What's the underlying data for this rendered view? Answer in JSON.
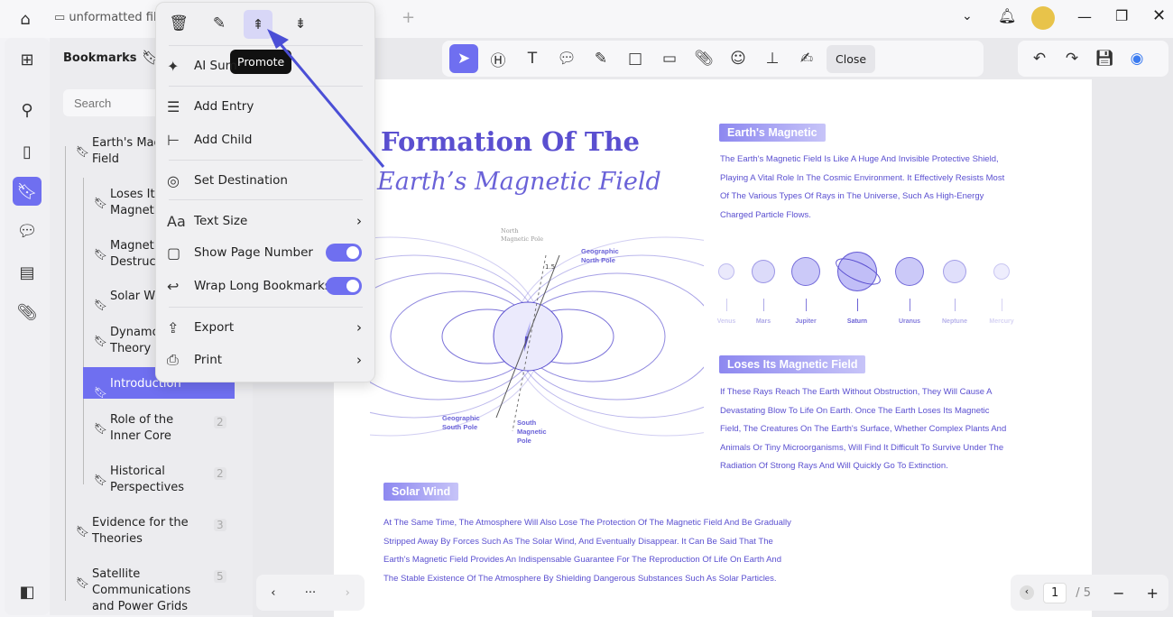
{
  "tab": {
    "title": "unformatted file"
  },
  "panel": {
    "title": "Bookmarks",
    "search_placeholder": "Search"
  },
  "bookmarks": [
    {
      "label": "Earth's Magnetic Field",
      "shown": "Earth's Mag\nField"
    },
    {
      "label": "Loses Its Magnetic",
      "shown": "Loses Its\nMagneti"
    },
    {
      "label": "Magnetic Destruct",
      "shown": "Magneti\nDestruct"
    },
    {
      "label": "Solar Wind",
      "shown": "Solar W"
    },
    {
      "label": "Dynamo Theory",
      "shown": "Dynamo\nTheory"
    },
    {
      "label": "Introduction",
      "shown": "Introduction"
    },
    {
      "label": "Role of the Inner Core",
      "shown": "Role of the\nInner Core",
      "page": "2"
    },
    {
      "label": "Historical Perspectives",
      "shown": "Historical\nPerspectives",
      "page": "2"
    },
    {
      "label": "Evidence for the Theories",
      "shown": "Evidence for the\nTheories",
      "page": "3"
    },
    {
      "label": "Satellite Communications and Power Grids",
      "shown": "Satellite\nCommunications\nand Power Grids",
      "page": "5"
    }
  ],
  "menu": {
    "tooltip": "Promote",
    "items": [
      "AI Summarize",
      "Add Entry",
      "Add Child",
      "Set Destination",
      "Text Size",
      "Show Page Number",
      "Wrap Long Bookmarks",
      "Export",
      "Print"
    ],
    "ai_shown": "AI Sum",
    "show_page_number": true,
    "wrap_long_bookmarks": true
  },
  "toolbar": {
    "close": "Close"
  },
  "document": {
    "title1": "Formation Of The",
    "title2": "Earth’s Magnetic Field",
    "diagram": {
      "north_mag": "North\nMagnetic Pole",
      "geo_north": "Geographic\nNorth Pole",
      "angle": "1.5",
      "geo_south": "Geographic\nSouth Pole",
      "south_mag": "South\nMagnetic\nPole"
    },
    "s1": {
      "heading": "Earth's Magnetic",
      "lines": [
        "The Earth's Magnetic Field Is Like A Huge And Invisible Protective Shield,",
        "Playing A Vital Role In The Cosmic Environment. It Effectively Resists Most",
        "Of The Various Types Of Rays in The Universe, Such As High-Energy",
        "Charged Particle Flows."
      ]
    },
    "planets": [
      "Venus",
      "Mars",
      "Jupiter",
      "Saturn",
      "Uranus",
      "Neptune",
      "Mercury"
    ],
    "s2": {
      "heading": "Loses Its Magnetic Field",
      "lines": [
        "If These Rays Reach The Earth Without Obstruction, They Will Cause A",
        "Devastating Blow To Life On Earth. Once The Earth Loses Its Magnetic",
        "Field, The Creatures On The Earth's Surface, Whether Complex Plants And",
        "Animals Or Tiny Microorganisms, Will Find It Difficult To Survive Under The",
        "Radiation Of Strong Rays And Will Quickly Go To Extinction."
      ]
    },
    "s3": {
      "heading": "Solar Wind",
      "lines": [
        "At The Same Time, The Atmosphere Will Also Lose The Protection Of The Magnetic Field And Be Gradually",
        "Stripped Away By Forces Such As The Solar Wind, And Eventually Disappear. It Can Be Said That The",
        "Earth's Magnetic Field Provides An Indispensable Guarantee For The Reproduction Of Life On Earth And",
        "The Stable Existence Of The Atmosphere By Shielding Dangerous Substances Such As Solar Particles."
      ]
    }
  },
  "pager": {
    "current": "1",
    "total": "/ 5",
    "more": "···"
  },
  "colors": {
    "accent": "#6f6ff0",
    "doc_text": "#5a4fd0",
    "arrow": "#4b4fd6"
  }
}
